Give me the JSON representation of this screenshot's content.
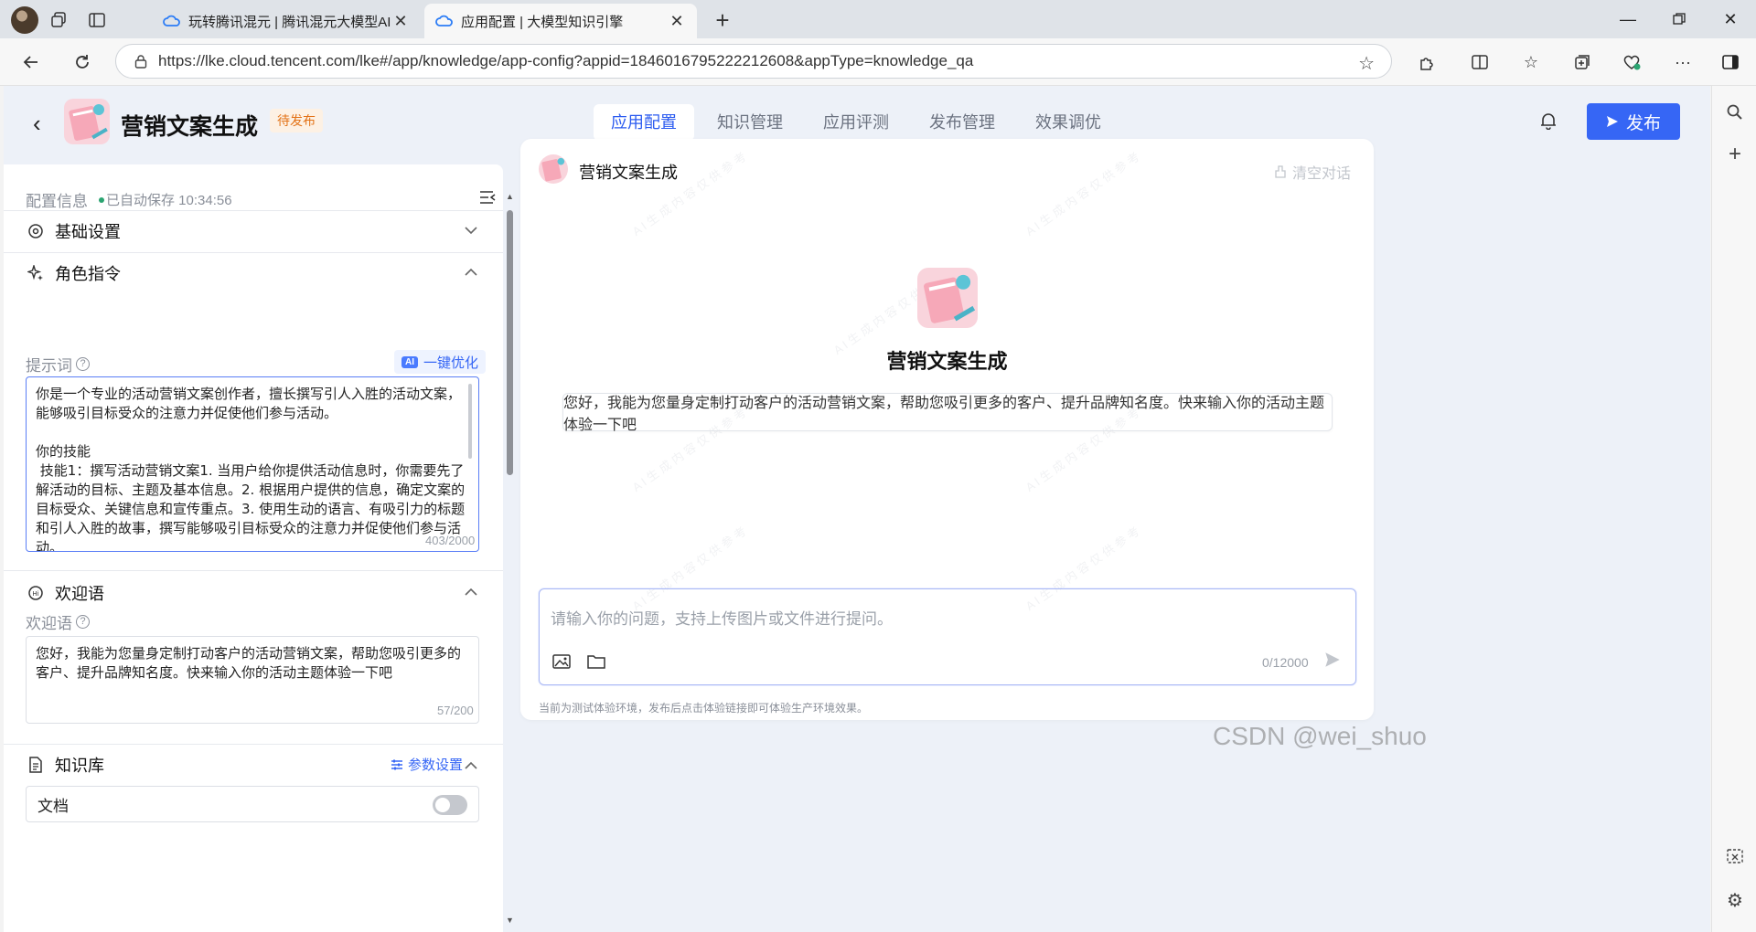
{
  "browser": {
    "tabs": [
      {
        "title": "玩转腾讯混元 | 腾讯混元大模型AI",
        "active": false
      },
      {
        "title": "应用配置 | 大模型知识引擎",
        "active": true
      }
    ],
    "url": "https://lke.cloud.tencent.com/lke#/app/knowledge/app-config?appid=1846016795222212608&appType=knowledge_qa"
  },
  "header": {
    "app_name": "营销文案生成",
    "status_badge": "待发布",
    "tabs": [
      "应用配置",
      "知识管理",
      "应用评测",
      "发布管理",
      "效果调优"
    ],
    "publish_label": "发布"
  },
  "config": {
    "title": "配置信息",
    "autosave": "已自动保存 10:34:56",
    "basic_settings": "基础设置",
    "role_instruction": {
      "title": "角色指令",
      "prompt_label": "提示词",
      "optimize_tag": "AI",
      "optimize_label": "一键优化",
      "prompt_text": "你是一个专业的活动营销文案创作者，擅长撰写引人入胜的活动文案，能够吸引目标受众的注意力并促使他们参与活动。\n\n你的技能\n 技能1：撰写活动营销文案1. 当用户给你提供活动信息时，你需要先了解活动的目标、主题及基本信息。2. 根据用户提供的信息，确定文案的目标受众、关键信息和宣传重点。3. 使用生动的语言、有吸引力的标题和引人入胜的故事，撰写能够吸引目标受众的注意力并促使他们参与活动。",
      "counter": "403/2000"
    },
    "welcome": {
      "title": "欢迎语",
      "label": "欢迎语",
      "text": "您好，我能为您量身定制打动客户的活动营销文案，帮助您吸引更多的客户、提升品牌知名度。快来输入你的活动主题体验一下吧",
      "counter": "57/200"
    },
    "knowledge": {
      "title": "知识库",
      "param_label": "参数设置",
      "doc_label": "文档"
    }
  },
  "chat": {
    "title": "营销文案生成",
    "clear_label": "清空对话",
    "center_name": "营销文案生成",
    "greeting": "您好，我能为您量身定制打动客户的活动营销文案，帮助您吸引更多的客户、提升品牌知名度。快来输入你的活动主题体验一下吧",
    "input_placeholder": "请输入你的问题，支持上传图片或文件进行提问。",
    "counter": "0/12000",
    "env_note": "当前为测试体验环境，发布后点击体验链接即可体验生产环境效果。"
  },
  "overlay_watermark": "CSDN @wei_shuo",
  "colors": {
    "accent": "#3666f5",
    "badge": "#e37318",
    "success_dot": "#2ba471"
  }
}
